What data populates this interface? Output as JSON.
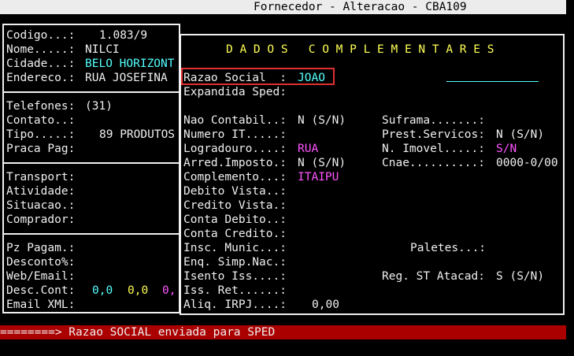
{
  "title": "Fornecedor - Alteracao - CBA109",
  "left": {
    "codigo_label": "Codigo...:",
    "codigo_value": "1.083/9",
    "nome_label": "Nome.....:",
    "nome_value": "NILCI",
    "cidade_label": "Cidade...:",
    "cidade_value": "BELO HORIZONT",
    "endereco_label": "Endereco.:",
    "endereco_value": "RUA JOSEFINA",
    "telefones_label": "Telefones:",
    "telefones_value": "(31)",
    "contato_label": "Contato..:",
    "tipo_label": "Tipo.....:",
    "tipo_value": "89 PRODUTOS",
    "praca_label": "Praca Pag:",
    "transport_label": "Transport:",
    "atividade_label": "Atividade:",
    "situacao_label": "Situacao.:",
    "comprador_label": "Comprador:",
    "pz_label": "Pz Pagam.:",
    "desconto_label": "Desconto%:",
    "web_label": "Web/Email:",
    "desc_cont_label": "Desc.Cont:",
    "desc1": "0,0",
    "desc2": "0,0",
    "desc3": "0,",
    "email_xml_label": "Email XML:"
  },
  "dados": {
    "header": "D A D O S   C O M P L E M E N T A R E S",
    "razao_label": "Razao Social  :",
    "razao_value": "JOAO",
    "expandida_label": "Expandida Sped:",
    "nao_contabil_label": "Nao Contabil..:",
    "nao_contabil_value": "N (S/N)",
    "numero_it_label": "Numero IT.....:",
    "logradouro_label": "Logradouro....:",
    "logradouro_value": "RUA",
    "arred_label": "Arred.Imposto.:",
    "arred_value": "N (S/N)",
    "complemento_label": "Complemento...:",
    "complemento_value": "ITAIPU",
    "debito_label": "Debito Vista..:",
    "credito_label": "Credito Vista.:",
    "conta_debito_label": "Conta Debito..:",
    "conta_credito_label": "Conta Credito.:",
    "insc_label": "Insc. Munic...:",
    "enq_label": "Enq. Simp.Nac.:",
    "isento_label": "Isento Iss....:",
    "iss_ret_label": "Iss. Ret......:",
    "aliq_label": "Aliq. IRPJ....:",
    "aliq_value": "0,00",
    "suframa_label": "Suframa.......:",
    "prest_label": "Prest.Servicos:",
    "prest_value": "N (S/N)",
    "imovel_label": "N. Imovel.....:",
    "imovel_value": "S/N",
    "cnae_label": "Cnae..........:",
    "cnae_value": "0000-0/00",
    "paletes_label": "Paletes...:",
    "reg_st_label": "Reg. ST Atacad:",
    "reg_st_value": "S (S/N)"
  },
  "status": "========> Razao SOCIAL enviada para SPED"
}
